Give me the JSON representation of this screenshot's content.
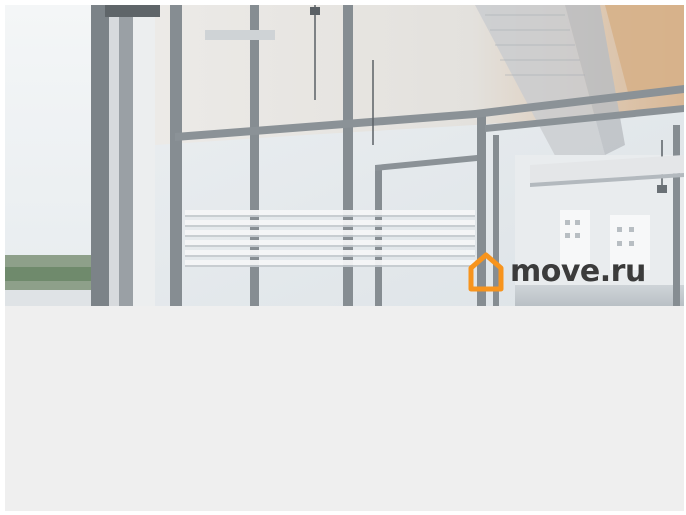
{
  "photo": {
    "subject": "office-glass-partitions",
    "colors": {
      "ceiling": "#ece9e4",
      "frame": "#8c9398",
      "glass": "#dfe5ea",
      "wood": "#d9b48a"
    }
  },
  "watermark": {
    "brand": "move.ru",
    "icon": "house-icon",
    "icon_color": "#f7941d"
  },
  "lower_panel": {
    "color": "#efefef"
  }
}
